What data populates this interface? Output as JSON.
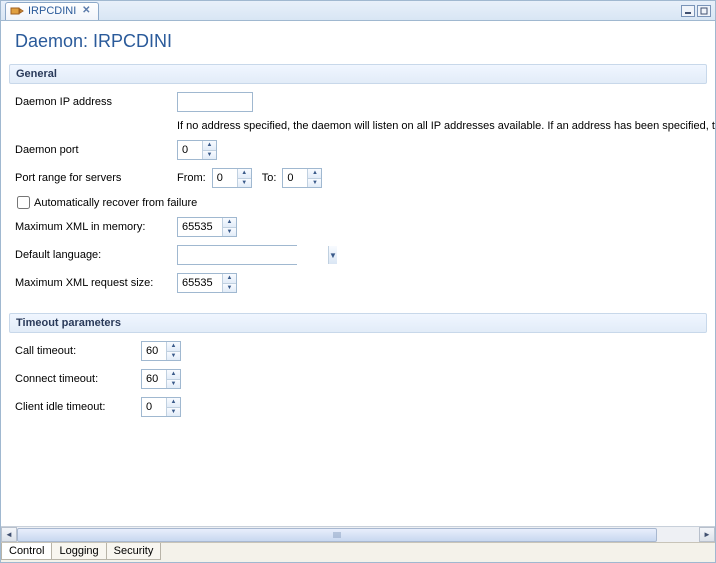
{
  "tab": {
    "title": "IRPCDINI"
  },
  "page": {
    "title": "Daemon: IRPCDINI"
  },
  "groups": {
    "general": {
      "header": "General",
      "ip_label": "Daemon IP address",
      "ip_value": "",
      "ip_hint": "If no address specified, the daemon will listen on all IP addresses available. If an address has been specified, the daemon will liste",
      "port_label": "Daemon port",
      "port_value": "0",
      "range_label": "Port range for servers",
      "range_from_label": "From:",
      "range_from_value": "0",
      "range_to_label": "To:",
      "range_to_value": "0",
      "auto_recover_label": "Automatically recover from failure",
      "auto_recover_checked": false,
      "max_xml_mem_label": "Maximum XML in memory:",
      "max_xml_mem_value": "65535",
      "default_lang_label": "Default language:",
      "default_lang_value": "",
      "max_xml_req_label": "Maximum XML request size:",
      "max_xml_req_value": "65535"
    },
    "timeout": {
      "header": "Timeout parameters",
      "call_label": "Call timeout:",
      "call_value": "60",
      "connect_label": "Connect timeout:",
      "connect_value": "60",
      "idle_label": "Client idle timeout:",
      "idle_value": "0"
    }
  },
  "bottom_tabs": {
    "control": "Control",
    "logging": "Logging",
    "security": "Security"
  }
}
